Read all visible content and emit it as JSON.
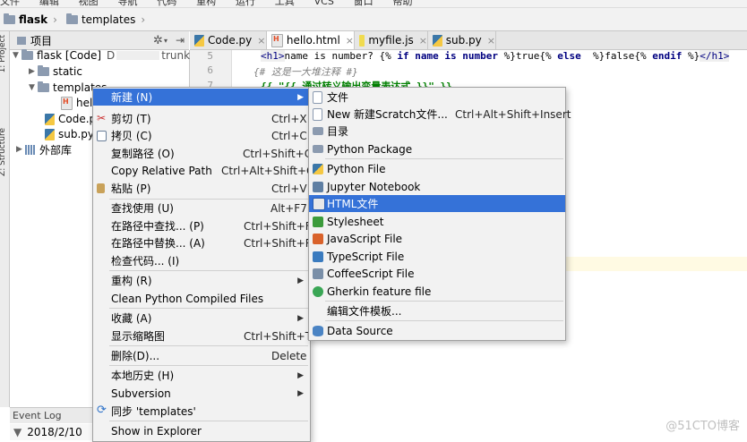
{
  "menubar": [
    "文件",
    "编辑",
    "视图",
    "导航",
    "代码",
    "重构",
    "运行",
    "工具",
    "VCS",
    "窗口",
    "帮助"
  ],
  "navbar": {
    "project": "flask",
    "folder": "templates"
  },
  "sidestrip": {
    "project_label": "1: Project",
    "structure_label": "Z: Structure"
  },
  "project_panel": {
    "title": "项目",
    "tree": [
      {
        "label": "flask [Code]",
        "suffix": "D",
        "tail": "trunk\\"
      },
      {
        "label": "static"
      },
      {
        "label": "templates"
      },
      {
        "label": "hell"
      },
      {
        "label": "Code.p"
      },
      {
        "label": "sub.py"
      },
      {
        "label": "外部库"
      }
    ]
  },
  "tabs": [
    {
      "label": "Code.py",
      "close": "×"
    },
    {
      "label": "hello.html",
      "close": "×"
    },
    {
      "label": "myfile.js",
      "close": "×"
    },
    {
      "label": "sub.py",
      "close": "×"
    }
  ],
  "editor": {
    "line_numbers": [
      "5",
      "6",
      "7"
    ],
    "line5": {
      "open_tag": "<h1>",
      "text": "name is number? ",
      "stmt_open": "{%",
      "kw_if": "if",
      "var": "name",
      "kw_is": "is",
      "test": "number",
      "stmt_close": "%}",
      "true_txt": "true",
      "else_open": "{%",
      "kw_else": "else",
      "else_close": "%}",
      "false_txt": "false",
      "endif_open": "{%",
      "kw_endif": "endif",
      "endif_close": "%}",
      "close_tag": "</h1>"
    },
    "line6": "{# 这是一大堆注释 #}",
    "line7": "{{ \"{{ 通过转义输出变量表达式 }}\" }}"
  },
  "context_menu": {
    "items": [
      {
        "label": "新建 (N)",
        "submenu": true,
        "selected": true
      },
      {
        "label": "剪切 (T)",
        "shortcut": "Ctrl+X",
        "icon": "cut-icon"
      },
      {
        "label": "拷贝 (C)",
        "shortcut": "Ctrl+C",
        "icon": "copy-icon"
      },
      {
        "label": "复制路径 (O)",
        "shortcut": "Ctrl+Shift+C"
      },
      {
        "label": "Copy Relative Path",
        "shortcut": "Ctrl+Alt+Shift+C"
      },
      {
        "label": "粘贴 (P)",
        "shortcut": "Ctrl+V",
        "icon": "paste-icon"
      },
      {
        "label": "查找使用 (U)",
        "shortcut": "Alt+F7"
      },
      {
        "label": "在路径中查找... (P)",
        "shortcut": "Ctrl+Shift+F"
      },
      {
        "label": "在路径中替换... (A)",
        "shortcut": "Ctrl+Shift+R"
      },
      {
        "label": "检查代码... (I)"
      },
      {
        "label": "重构 (R)",
        "submenu": true
      },
      {
        "label": "Clean Python Compiled Files"
      },
      {
        "label": "收藏 (A)",
        "submenu": true
      },
      {
        "label": "显示缩略图",
        "shortcut": "Ctrl+Shift+T"
      },
      {
        "label": "删除(D)...",
        "shortcut": "Delete"
      },
      {
        "label": "本地历史 (H)",
        "submenu": true
      },
      {
        "label": "Subversion",
        "submenu": true
      },
      {
        "label": "同步 'templates'",
        "icon": "sync-icon"
      },
      {
        "label": "Show in Explorer"
      }
    ]
  },
  "new_submenu": {
    "items": [
      {
        "label": "文件",
        "icon": "file-icon"
      },
      {
        "label": "New 新建Scratch文件...",
        "shortcut": "Ctrl+Alt+Shift+Insert",
        "icon": "scratch-icon"
      },
      {
        "label": "目录",
        "icon": "directory-icon"
      },
      {
        "label": "Python Package",
        "icon": "python-package-icon"
      },
      {
        "label": "Python File",
        "icon": "python-file-icon"
      },
      {
        "label": "Jupyter Notebook",
        "icon": "jupyter-icon"
      },
      {
        "label": "HTML文件",
        "icon": "html-file-icon",
        "selected": true
      },
      {
        "label": "Stylesheet",
        "icon": "css-icon"
      },
      {
        "label": "JavaScript File",
        "icon": "js-icon"
      },
      {
        "label": "TypeScript File",
        "icon": "ts-icon"
      },
      {
        "label": "CoffeeScript File",
        "icon": "coffeescript-icon"
      },
      {
        "label": "Gherkin feature file",
        "icon": "gherkin-icon"
      },
      {
        "label": "编辑文件模板...",
        "icon": ""
      },
      {
        "label": "Data Source",
        "icon": "data-source-icon"
      }
    ]
  },
  "event_log": {
    "title": "Event Log",
    "date": "2018/2/10"
  },
  "watermark": "@51CTO博客"
}
